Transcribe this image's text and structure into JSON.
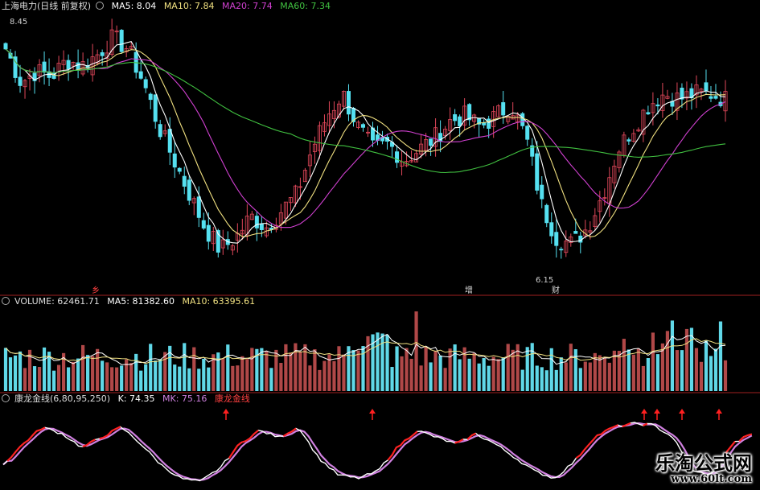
{
  "header": {
    "price_title": "上海电力(日线 前复权)",
    "ma5": "MA5: 8.04",
    "ma10": "MA10: 7.84",
    "ma20": "MA20: 7.74",
    "ma60": "MA60: 7.34",
    "volume_title": "VOLUME: 62461.71",
    "vol_ma5": "MA5: 81382.60",
    "vol_ma10": "MA10: 63395.61",
    "ind_title": "康龙金线(6,80,95,250)",
    "ind_k": "K: 74.35",
    "ind_mk": "MK: 75.16",
    "ind_name": "康龙金线"
  },
  "annotations": {
    "high_label": "8.45",
    "low_label": "6.15",
    "marker_1": "乡",
    "marker_2": "增",
    "marker_3": "财"
  },
  "watermark": {
    "line1": "乐淘公式网",
    "line2": "www.60lt.com"
  },
  "colors": {
    "up": "#e0475a",
    "down": "#55e0f0",
    "ma5": "#ffffff",
    "ma10": "#f0e080",
    "ma20": "#d040d0",
    "ma60": "#40c040",
    "k_line": "#ffffff",
    "mk_line": "#d080e0",
    "signal": "#ff2020"
  },
  "chart_data": [
    {
      "type": "candlestick",
      "title": "上海电力(日线 前复权)",
      "y_range": [
        6.15,
        8.45
      ],
      "close_path": [
        8.2,
        7.9,
        8.0,
        7.95,
        8.1,
        8.05,
        8.15,
        8.3,
        8.2,
        7.9,
        7.5,
        7.2,
        6.9,
        6.6,
        6.4,
        6.5,
        6.7,
        6.6,
        6.75,
        6.9,
        7.3,
        7.6,
        7.8,
        7.5,
        7.3,
        7.35,
        7.2,
        7.3,
        7.4,
        7.55,
        7.6,
        7.5,
        7.6,
        7.7,
        7.4,
        6.8,
        6.5,
        6.45,
        6.6,
        6.9,
        7.3,
        7.5,
        7.7,
        7.8,
        7.75,
        7.8,
        7.8,
        7.75
      ]
    },
    {
      "type": "bar",
      "title": "VOLUME",
      "values": [
        62461.71
      ],
      "series": [
        {
          "name": "MA5",
          "values": [
            81382.6
          ]
        },
        {
          "name": "MA10",
          "values": [
            63395.61
          ]
        }
      ]
    },
    {
      "type": "line",
      "title": "康龙金线(6,80,95,250)",
      "series": [
        {
          "name": "K",
          "values": [
            74.35
          ]
        },
        {
          "name": "MK",
          "values": [
            75.16
          ]
        }
      ],
      "k_path": [
        30,
        60,
        85,
        75,
        55,
        70,
        85,
        60,
        30,
        10,
        5,
        25,
        60,
        80,
        70,
        85,
        40,
        15,
        10,
        20,
        55,
        80,
        70,
        60,
        75,
        60,
        40,
        20,
        10,
        35,
        70,
        85,
        90,
        88,
        70,
        20,
        15,
        60,
        75
      ]
    }
  ]
}
